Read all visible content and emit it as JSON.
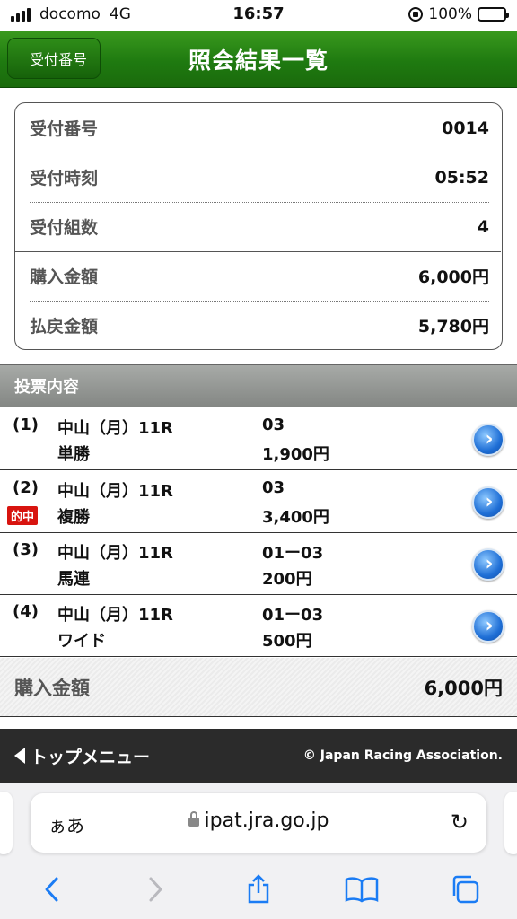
{
  "status_bar": {
    "carrier": "docomo",
    "network": "4G",
    "time": "16:57",
    "battery": "100%"
  },
  "header": {
    "back_label": "受付番号",
    "title": "照会結果一覧"
  },
  "summary": {
    "rows": [
      {
        "label": "受付番号",
        "value": "0014"
      },
      {
        "label": "受付時刻",
        "value": "05:52"
      },
      {
        "label": "受付組数",
        "value": "4"
      },
      {
        "label": "購入金額",
        "value": "6,000円"
      },
      {
        "label": "払戻金額",
        "value": "5,780円"
      }
    ]
  },
  "section_title": "投票内容",
  "bets": [
    {
      "num": "(1)",
      "race": "中山（月）11R",
      "type": "単勝",
      "combo": "03",
      "amount": "1,900円",
      "badge": ""
    },
    {
      "num": "(2)",
      "race": "中山（月）11R",
      "type": "複勝",
      "combo": "03",
      "amount": "3,400円",
      "badge": "的中"
    },
    {
      "num": "(3)",
      "race": "中山（月）11R",
      "type": "馬連",
      "combo": "01ー03",
      "amount": "200円",
      "badge": ""
    },
    {
      "num": "(4)",
      "race": "中山（月）11R",
      "type": "ワイド",
      "combo": "01ー03",
      "amount": "500円",
      "badge": ""
    }
  ],
  "total": {
    "label": "購入金額",
    "value": "6,000円"
  },
  "footer": {
    "top_menu": "トップメニュー",
    "copyright": "© Japan Racing Association."
  },
  "browser": {
    "aa": "ぁあ",
    "url": "ipat.jra.go.jp",
    "reload_icon": "reload-icon",
    "colors": {
      "accent": "#1b7cf4",
      "header_green": "#1f7a10",
      "hit_red": "#d8140f"
    }
  }
}
